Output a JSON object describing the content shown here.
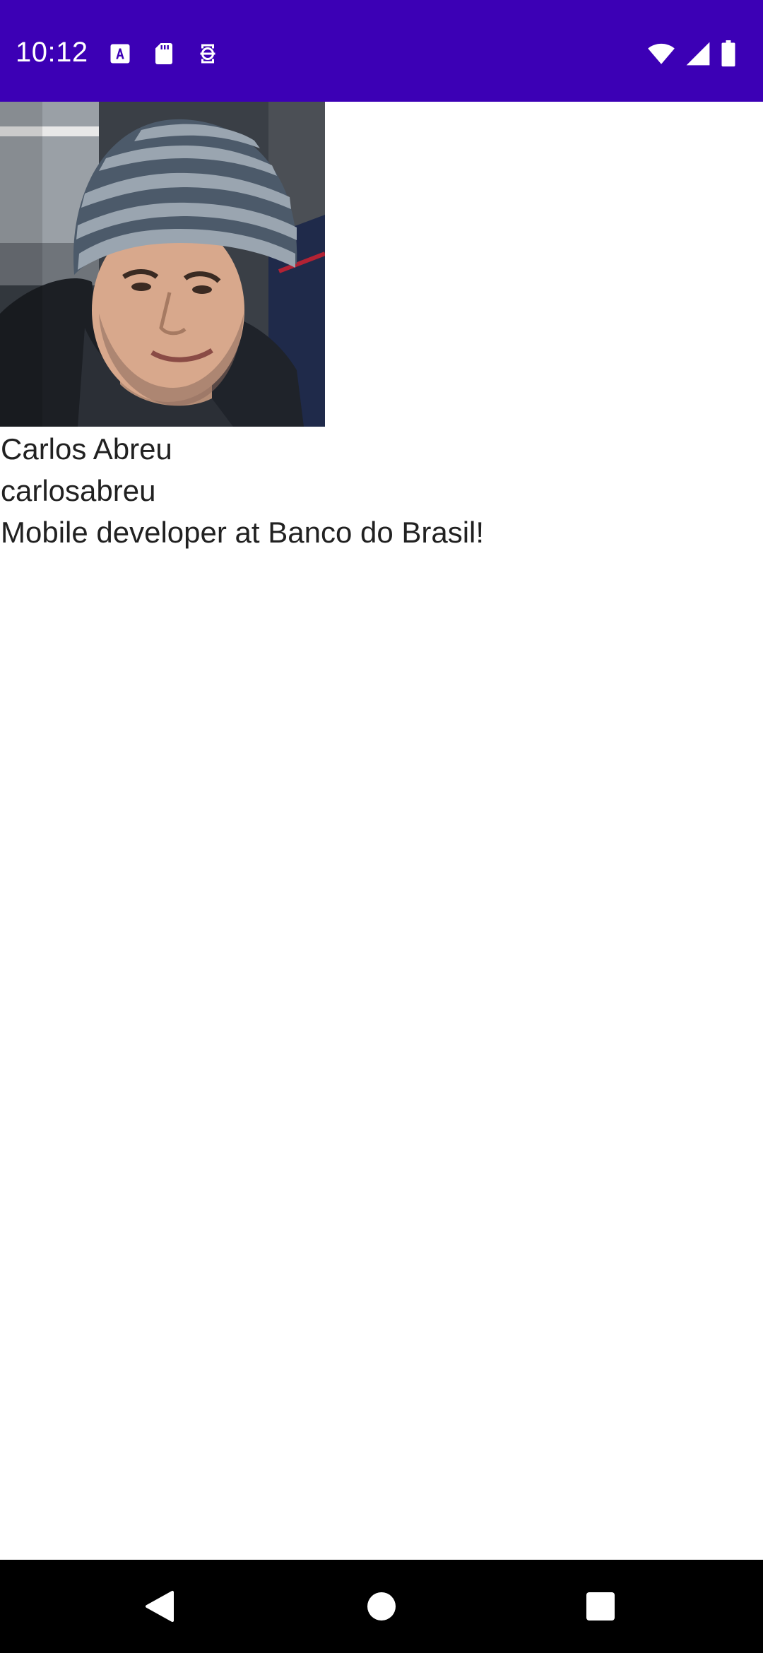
{
  "status_bar": {
    "time": "10:12",
    "background": "#3c00b5",
    "left_icons": [
      "font-a-icon",
      "sd-card-icon",
      "sync-icon"
    ],
    "right_icons": [
      "wifi-icon",
      "signal-icon",
      "battery-icon"
    ]
  },
  "profile": {
    "avatar_icon": "user-photo",
    "name": "Carlos Abreu",
    "login": "carlosabreu",
    "bio": "Mobile developer at Banco do Brasil!"
  },
  "nav_bar": {
    "back": "back-icon",
    "home": "home-icon",
    "recents": "recents-icon"
  }
}
